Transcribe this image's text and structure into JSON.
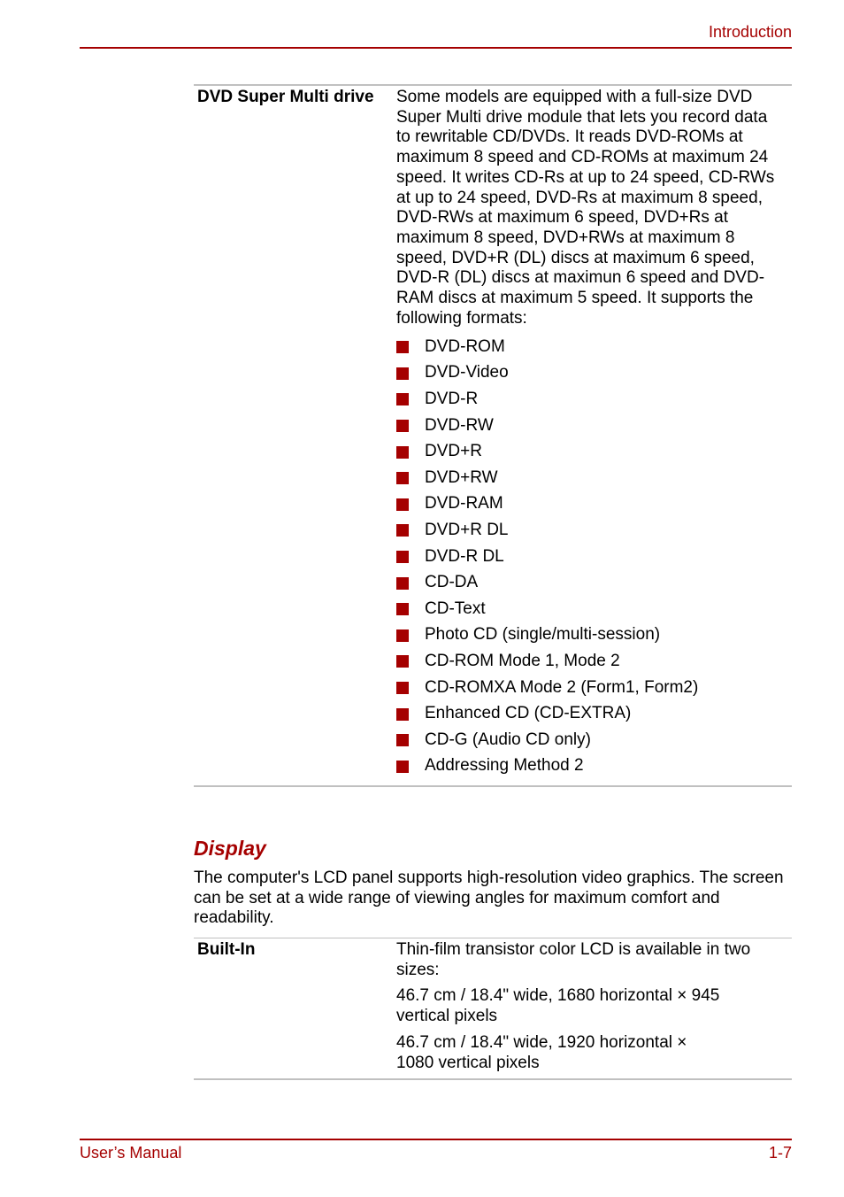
{
  "header": {
    "section": "Introduction"
  },
  "dvd_drive": {
    "label": "DVD Super Multi drive",
    "description": "Some models are equipped with a full-size DVD Super Multi drive module that lets you record data to rewritable CD/DVDs. It reads DVD-ROMs at maximum 8 speed and CD-ROMs at maximum 24 speed. It writes CD-Rs at up to 24 speed, CD-RWs at up to 24 speed, DVD-Rs at maximum 8 speed, DVD-RWs at maximum 6 speed, DVD+Rs at maximum 8 speed, DVD+RWs at maximum 8 speed, DVD+R (DL) discs at maximum 6 speed, DVD-R (DL) discs at maximun 6 speed and DVD-RAM discs at maximum 5 speed. It supports the following formats:",
    "formats": [
      "DVD-ROM",
      "DVD-Video",
      "DVD-R",
      "DVD-RW",
      "DVD+R",
      "DVD+RW",
      "DVD-RAM",
      "DVD+R DL",
      "DVD-R DL",
      "CD-DA",
      "CD-Text",
      "Photo CD (single/multi-session)",
      "CD-ROM Mode 1, Mode 2",
      "CD-ROMXA Mode 2 (Form1, Form2)",
      "Enhanced CD (CD-EXTRA)",
      "CD-G (Audio CD only)",
      "Addressing Method 2"
    ]
  },
  "display": {
    "title": "Display",
    "intro": "The computer's LCD panel supports high-resolution video graphics. The screen can be set at a wide range of viewing angles for maximum comfort and readability.",
    "builtin": {
      "label": "Built-In",
      "paragraphs": [
        "Thin-film transistor color LCD is available in two sizes:",
        "46.7 cm / 18.4\" wide, 1680 horizontal × 945 vertical pixels",
        "46.7 cm / 18.4\" wide, 1920 horizontal × 1080 vertical pixels"
      ]
    }
  },
  "footer": {
    "manual": "User’s Manual",
    "page": "1-7"
  },
  "colors": {
    "accent": "#a50000",
    "rule": "#c0c0c0",
    "text": "#000000"
  }
}
